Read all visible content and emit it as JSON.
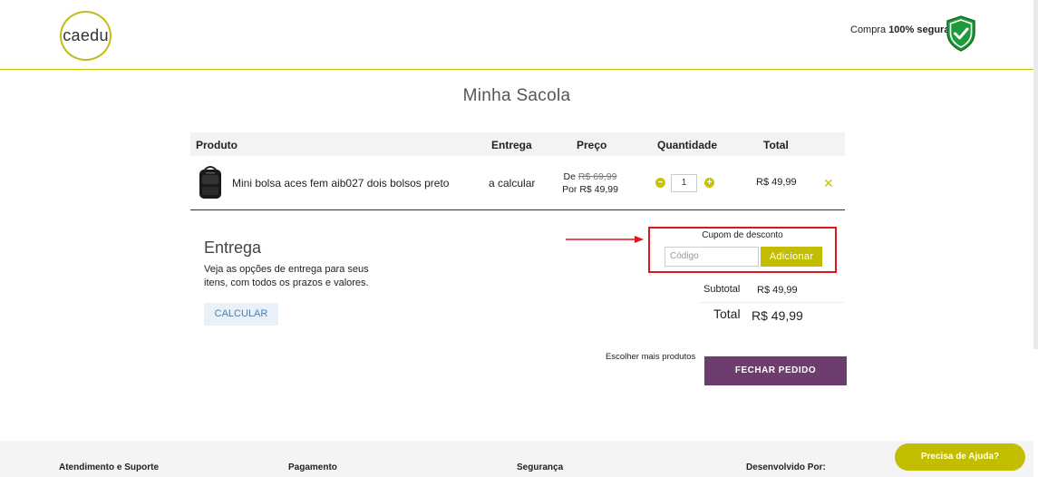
{
  "header": {
    "logo_text": "caedu",
    "secure_prefix": "Compra ",
    "secure_bold": "100% segura",
    "shield_color": "#1e9a3a"
  },
  "page_title": "Minha Sacola",
  "cart": {
    "columns": {
      "product": "Produto",
      "delivery": "Entrega",
      "price": "Preço",
      "quantity": "Quantidade",
      "total": "Total"
    },
    "items": [
      {
        "name": "Mini bolsa aces fem aib027 dois bolsos preto",
        "delivery": "a calcular",
        "price_from_label": "De ",
        "price_from": "R$ 69,99",
        "price_to": "Por R$ 49,99",
        "quantity": "1",
        "total": "R$ 49,99"
      }
    ]
  },
  "shipping": {
    "title": "Entrega",
    "description": "Veja as opções de entrega para seus itens, com todos os prazos e valores.",
    "calc_label": "CALCULAR"
  },
  "coupon": {
    "label": "Cupom de desconto",
    "placeholder": "Código",
    "add_label": "Adicionar"
  },
  "summary": {
    "subtotal_label": "Subtotal",
    "subtotal_value": "R$ 49,99",
    "total_label": "Total",
    "total_value": "R$ 49,99"
  },
  "actions": {
    "more_products": "Escolher mais produtos",
    "checkout": "FECHAR PEDIDO"
  },
  "footer": {
    "col1": "Atendimento e Suporte",
    "col2": "Pagamento",
    "col3": "Segurança",
    "col4": "Desenvolvido Por:",
    "help": "Precisa de Ajuda?"
  },
  "colors": {
    "accent": "#c2bd00",
    "checkout": "#6d3d6f",
    "highlight": "#e0141a"
  }
}
